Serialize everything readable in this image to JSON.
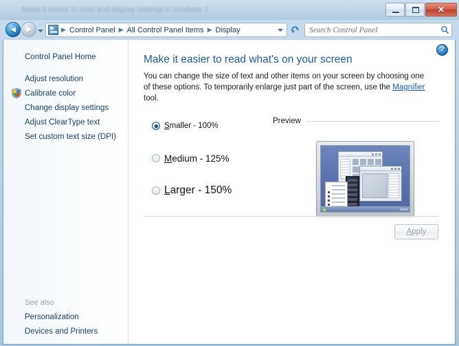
{
  "window": {
    "titlebar_text": "Make it easier to read and display settings in windows 7",
    "minimize_label": "Minimize",
    "maximize_label": "Maximize",
    "close_label": "Close",
    "close_glyph": "✕"
  },
  "toolbar": {
    "back_label": "Back",
    "back_glyph": "◄",
    "forward_label": "Forward",
    "forward_glyph": "►",
    "recent_pages_label": "Recent pages",
    "breadcrumbs": [
      {
        "label": "Control Panel"
      },
      {
        "label": "All Control Panel Items"
      },
      {
        "label": "Display"
      }
    ],
    "breadcrumb_separator": "▶",
    "address_dropdown_label": "Previous locations",
    "refresh_label": "Refresh",
    "control_panel_icon": "control-panel-icon"
  },
  "search": {
    "placeholder": "Search Control Panel",
    "value": "",
    "icon": "search-icon"
  },
  "sidebar": {
    "home_label": "Control Panel Home",
    "items": [
      {
        "label": "Adjust resolution",
        "shield": false
      },
      {
        "label": "Calibrate color",
        "shield": true
      },
      {
        "label": "Change display settings",
        "shield": false
      },
      {
        "label": "Adjust ClearType text",
        "shield": false
      },
      {
        "label": "Set custom text size (DPI)",
        "shield": false
      }
    ],
    "see_also_label": "See also",
    "see_also_items": [
      {
        "label": "Personalization"
      },
      {
        "label": "Devices and Printers"
      }
    ]
  },
  "content": {
    "help_label": "Help",
    "help_glyph": "?",
    "heading": "Make it easier to read what's on your screen",
    "description_part1": "You can change the size of text and other items on your screen by choosing one of these options. To temporarily enlarge just part of the screen, use the ",
    "magnifier_link": "Magnifier",
    "description_part2": " tool.",
    "preview_label": "Preview",
    "preview_image": "desktop-preview-thumbnail",
    "scale_options": [
      {
        "label_access_key": "S",
        "label_rest": "maller - 100%",
        "selected": true
      },
      {
        "label_access_key": "M",
        "label_rest": "edium - 125%",
        "selected": false
      },
      {
        "label_access_key": "L",
        "label_rest": "arger - 150%",
        "selected": false
      }
    ],
    "apply_access_key": "A",
    "apply_rest": "pply",
    "apply_enabled": false
  },
  "colors": {
    "accent": "#1f5b9b",
    "link": "#1a5fb4",
    "close_button": "#cf5b46",
    "desktop_preview": "#5b74ae"
  }
}
